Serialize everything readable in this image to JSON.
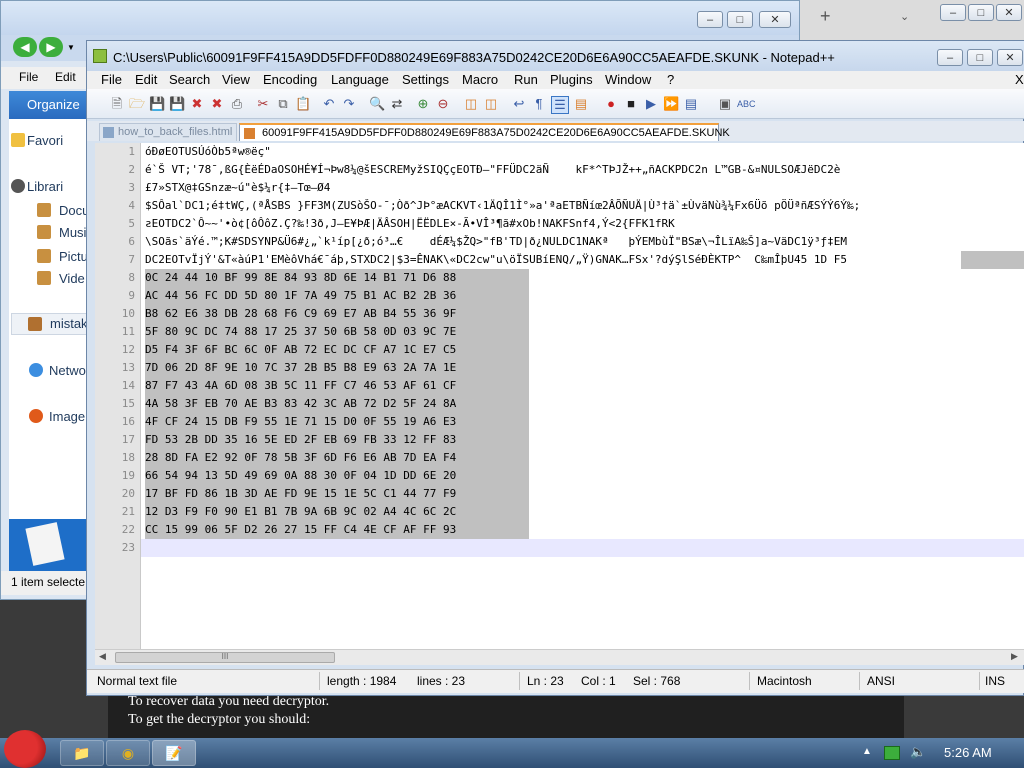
{
  "ransom_note": {
    "line1": "To recover data you need decryptor.",
    "line2": "To get the decryptor you should:"
  },
  "explorer": {
    "menu": [
      "File",
      "Edit"
    ],
    "toolbar_label": "Organize",
    "nav_items": [
      "Favori",
      "Librari",
      "Docu",
      "Musi",
      "Pictu",
      "Vide",
      "mistak",
      "Netwo",
      "Image"
    ],
    "status": "1 item selecte"
  },
  "browser": {
    "new_tab": "+"
  },
  "npp": {
    "title": "C:\\Users\\Public\\60091F9FF415A9DD5FDFF0D880249E69F883A75D0242CE20D6E6A90CC5AEAFDE.SKUNK - Notepad++",
    "menu": [
      "File",
      "Edit",
      "Search",
      "View",
      "Encoding",
      "Language",
      "Settings",
      "Macro",
      "Run",
      "Plugins",
      "Window",
      "?"
    ],
    "close_x": "X",
    "tabs": [
      {
        "label": "how_to_back_files.html"
      },
      {
        "label": "60091F9FF415A9DD5FDFF0D880249E69F883A75D0242CE20D6E6A90CC5AEAFDE.SKUNK"
      }
    ],
    "lines": [
      "óÐøEOTUSÚóÒb5ªw®ëç\"",
      "é`Š VT;'78¯,ßG{ÈëÉDaOSOHÉ¥Í¬Þw8¼@šESCREMyžSIQÇçEOTÐ—\"FFÜDC2äÑ    kF*^TÞJŽ++„ñACKPDC2n L™GB-&¤NULSOÆJëDC2è",
      "£7»STX@‡GSnzæ~ú\"è$¼r{‡—Tœ—Ø4",
      "$SÔal`DC1;é‡tWÇ,(ªÅSBS }FF3M(ZUSòŠO-¯;Òð^JÞ°æACKVT‹1ÄQÎ1Ì°»a'ªaETBÑíœ2ÂÕÑUÄ|Ù³†ä`±ÙväNù¾¼Fx6Üõ pÖÜªñÆSÝÝ6Ý‰;",
      "ƨEOTDC2`Ô~~'•ò¢[ôÔôZ.Ç?‰!3ð,J—E¥ÞÆ|ÄÂSOH|ËËDLE×-Ã•VÎ³¶ã#xOb!NAKFSnf4,Ý<2{FFK1fRK",
      "\\SOãs`äÝé.™;K#SDSYNP&Ü6#¿„`k¹íp[¿ð;ó³…€    dÉÆ¼$ŽQ>\"fB'TD|ð¿NULDC1NAKª   þÝEMbùÏ\"BSæ\\¬ÎLïA‰Š]a~VäDC1ÿ³ƒ‡EM",
      "DC2EOTvÏjÝ'&T«àúP1'EMèôVhá€¯áþ,STXDC2|$3=ÊNAK\\«DC2cw\"u\\öÏSUBíENQ/„Ÿ)GNAK…FSx'?dýŞlSéÐÈKTP^  C‰mÎþU45 1D F5",
      "0C 24 44 10 BF 99 8E 84 93 8D 6E 14 B1 71 D6 88",
      "AC 44 56 FC DD 5D 80 1F 7A 49 75 B1 AC B2 2B 36",
      "B8 62 E6 38 DB 28 68 F6 C9 69 E7 AB B4 55 36 9F",
      "5F 80 9C DC 74 88 17 25 37 50 6B 58 0D 03 9C 7E",
      "D5 F4 3F 6F BC 6C 0F AB 72 EC DC CF A7 1C E7 C5",
      "7D 06 2D 8F 9E 10 7C 37 2B B5 B8 E9 63 2A 7A 1E",
      "87 F7 43 4A 6D 08 3B 5C 11 FF C7 46 53 AF 61 CF",
      "4A 58 3F EB 70 AE B3 83 42 3C AB 72 D2 5F 24 8A",
      "4F CF 24 15 DB F9 55 1E 71 15 D0 0F 55 19 A6 E3",
      "FD 53 2B DD 35 16 5E ED 2F EB 69 FB 33 12 FF 83",
      "28 8D FA E2 92 0F 78 5B 3F 6D F6 E6 AB 7D EA F4",
      "66 54 94 13 5D 49 69 0A 88 30 0F 04 1D DD 6E 20",
      "17 BF FD 86 1B 3D AE FD 9E 15 1E 5C C1 44 77 F9",
      "12 D3 F9 F0 90 E1 B1 7B 9A 6B 9C 02 A4 4C 6C 2C",
      "CC 15 99 06 5F D2 26 27 15 FF C4 4E CF AF FF 93",
      ""
    ],
    "scroll_thumb": "III",
    "status": {
      "type": "Normal text file",
      "length": "length : 1984",
      "lines": "lines : 23",
      "ln": "Ln : 23",
      "col": "Col : 1",
      "sel": "Sel : 768",
      "eol": "Macintosh",
      "encoding": "ANSI",
      "mode": "INS"
    }
  },
  "taskbar": {
    "clock": "5:26 AM"
  },
  "colors": {
    "accent": "#f2a03d",
    "selection": "#c0c0c0",
    "taskbar": "#2f4f74"
  }
}
